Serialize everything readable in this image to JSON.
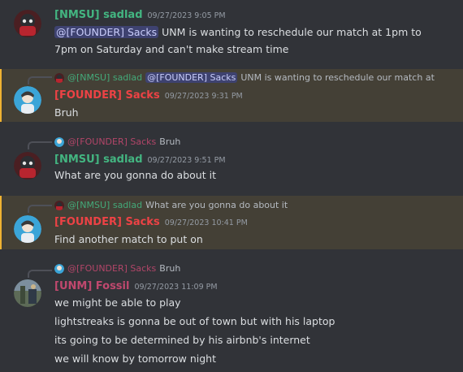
{
  "colors": {
    "green": "#43b581",
    "red": "#ed4245",
    "pink": "#c0486e",
    "highlight": "#444036",
    "accent": "#f0b232"
  },
  "messages": [
    {
      "author": "[NMSU] sadlad",
      "time": "09/27/2023 9:05 PM",
      "mention": "@[FOUNDER] Sacks",
      "line1_rest": " UNM is wanting to reschedule our match at 1pm to",
      "line2": "7pm on Saturday and can't make stream time"
    },
    {
      "reply_mention_author": "@[NMSU] sadlad",
      "reply_mention": "@[FOUNDER] Sacks",
      "reply_text": " UNM is wanting to reschedule our match at",
      "author": "[FOUNDER] Sacks",
      "time": "09/27/2023 9:31 PM",
      "line1": "Bruh"
    },
    {
      "reply_author": "@[FOUNDER] Sacks",
      "reply_text": "Bruh",
      "author": "[NMSU] sadlad",
      "time": "09/27/2023 9:51 PM",
      "line1": "What are you gonna do about it"
    },
    {
      "reply_author": "@[NMSU] sadlad",
      "reply_text": "What are you gonna do about it",
      "author": "[FOUNDER] Sacks",
      "time": "09/27/2023 10:41 PM",
      "line1": "Find another match to put on"
    },
    {
      "reply_author": "@[FOUNDER] Sacks",
      "reply_text": "Bruh",
      "author": "[UNM] Fossil",
      "time": "09/27/2023 11:09 PM",
      "lines": [
        "we might be able to play",
        "lightstreaks is gonna be out of town but with his laptop",
        "its going to be determined by his airbnb's internet",
        "we will know by tomorrow night"
      ]
    }
  ]
}
